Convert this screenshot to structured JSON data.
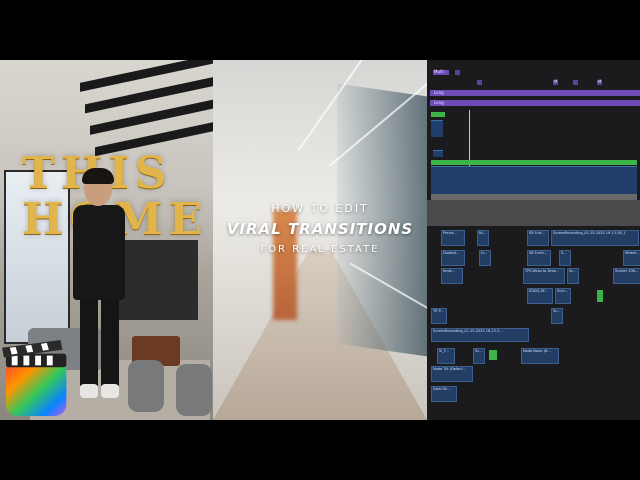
{
  "thumbnail": {
    "overlay_word_1": "THIS",
    "overlay_word_2": "HOME",
    "center_line_1": "HOW TO EDIT",
    "center_line_2": "VIRAL TRANSITIONS",
    "center_line_3": "FOR REAL ESTATE"
  },
  "timeline": {
    "top_marker": "Multi",
    "lane_1": "Long",
    "lane_2": "Long",
    "small_markers": [
      "M",
      "M"
    ],
    "thumbs": [
      "Previs...",
      "Ni...",
      "SB Furt...",
      "ScreenRecording_01-25-2025 19-13-38_1",
      "Doorbd...",
      "H...",
      "SB Furth...",
      "S...",
      "Wheel...",
      "Impe...",
      "TPS-Wrap to Drop...",
      "Sc...",
      "Sceder 336...",
      "EDDQ-SF...",
      "Scre...",
      "TR P...",
      "Sc...",
      "ScreenRecording_01-25-2025 16-13-3...",
      "Sl_F...",
      "Sc...",
      "Node Basic (B...",
      "Node Tilt (Defaul...",
      "Dark Dh..."
    ]
  },
  "colors": {
    "gold": "#e1b54b",
    "timeline_purple": "#6d4bb8",
    "clip_blue": "#1f3e6b",
    "clip_green": "#3db34a"
  }
}
